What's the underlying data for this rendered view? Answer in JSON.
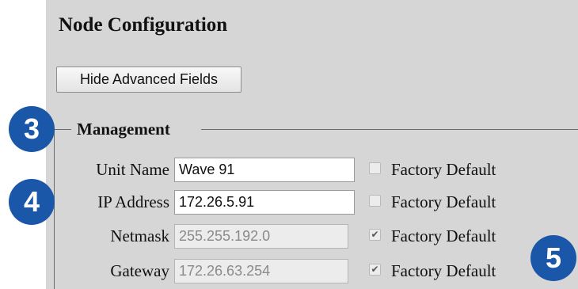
{
  "page": {
    "title": "Node Configuration",
    "toggle_button_label": "Hide Advanced Fields"
  },
  "management": {
    "legend": "Management",
    "fields": [
      {
        "label": "Unit Name",
        "value": "Wave 91",
        "factory_default_label": "Factory Default",
        "factory_default_checked": false,
        "disabled": false
      },
      {
        "label": "IP Address",
        "value": "172.26.5.91",
        "factory_default_label": "Factory Default",
        "factory_default_checked": false,
        "disabled": false
      },
      {
        "label": "Netmask",
        "value": "255.255.192.0",
        "factory_default_label": "Factory Default",
        "factory_default_checked": true,
        "disabled": true
      },
      {
        "label": "Gateway",
        "value": "172.26.63.254",
        "factory_default_label": "Factory Default",
        "factory_default_checked": true,
        "disabled": true
      }
    ]
  },
  "annotations": {
    "badge_3": "3",
    "badge_4": "4",
    "badge_5": "5",
    "color": "#1a57a8"
  },
  "icons": {
    "checked_mark": "✔"
  }
}
